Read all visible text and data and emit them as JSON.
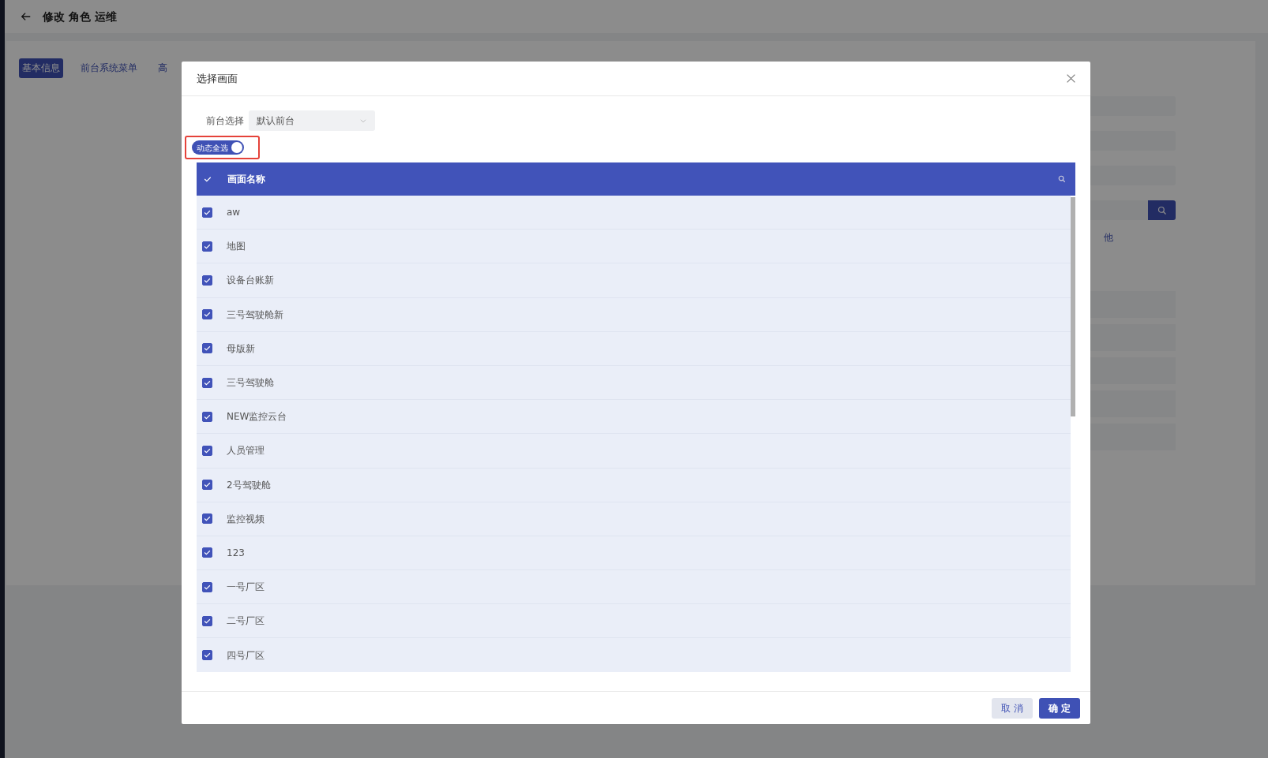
{
  "page": {
    "title": "修改 角色 运维",
    "tabs": [
      {
        "label": "基本信息",
        "selected": true
      },
      {
        "label": "前台系统菜单",
        "selected": false
      },
      {
        "label": "高",
        "selected": false
      }
    ],
    "side_link": "他"
  },
  "dialog": {
    "title": "选择画面",
    "frontend_select": {
      "label": "前台选择",
      "value": "默认前台"
    },
    "dynamic_select_all": {
      "label": "动态全选",
      "on": true
    },
    "table": {
      "header": {
        "title": "画面名称",
        "checked": true
      },
      "rows": [
        {
          "name": "aw",
          "checked": true
        },
        {
          "name": "地图",
          "checked": true
        },
        {
          "name": "设备台账新",
          "checked": true
        },
        {
          "name": "三号驾驶舱新",
          "checked": true
        },
        {
          "name": "母版新",
          "checked": true
        },
        {
          "name": "三号驾驶舱",
          "checked": true
        },
        {
          "name": "NEW监控云台",
          "checked": true
        },
        {
          "name": "人员管理",
          "checked": true
        },
        {
          "name": "2号驾驶舱",
          "checked": true
        },
        {
          "name": "监控视频",
          "checked": true
        },
        {
          "name": "123",
          "checked": true
        },
        {
          "name": "一号厂区",
          "checked": true
        },
        {
          "name": "二号厂区",
          "checked": true
        },
        {
          "name": "四号厂区",
          "checked": true
        }
      ]
    },
    "buttons": [
      {
        "label": "取 消",
        "kind": "secondary"
      },
      {
        "label": "确 定",
        "kind": "primary"
      }
    ]
  }
}
